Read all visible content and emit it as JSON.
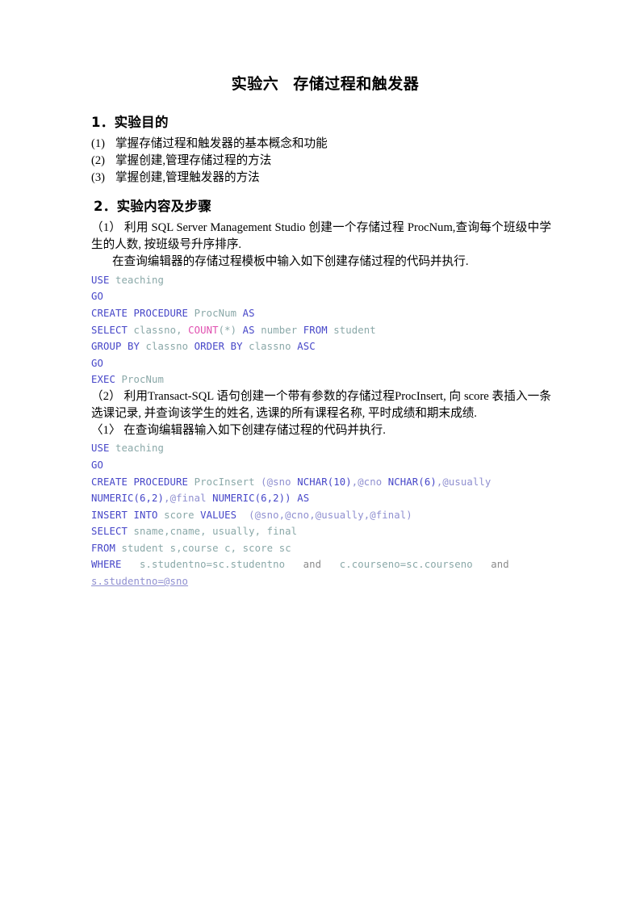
{
  "document": {
    "title_main": "实验六",
    "title_sub": "存储过程和触发器",
    "sections": [
      {
        "heading": "1．实验目的",
        "items": [
          {
            "num": "(1)",
            "text": "掌握存储过程和触发器的基本概念和功能"
          },
          {
            "num": "(2)",
            "text": "掌握创建,管理存储过程的方法"
          },
          {
            "num": "(3)",
            "text": "掌握创建,管理触发器的方法"
          }
        ]
      },
      {
        "heading": "2．实验内容及步骤",
        "paragraphs": [
          "（1） 利用 SQL Server Management Studio 创建一个存储过程 ProcNum,查询每个班级中学生的人数, 按班级号升序排序.",
          "在查询编辑器的存储过程模板中输入如下创建存储过程的代码并执行.",
          "（2） 利用Transact-SQL 语句创建一个带有参数的存储过程ProcInsert, 向 score 表插入一条选课记录, 并查询该学生的姓名, 选课的所有课程名称, 平时成绩和期末成绩.",
          "〈1〉 在查询编辑器输入如下创建存储过程的代码并执行."
        ]
      }
    ]
  },
  "code_block_1": {
    "lines": [
      [
        {
          "t": "USE",
          "c": "kw"
        },
        {
          "t": " ",
          "c": "plain"
        },
        {
          "t": "teaching",
          "c": "ident"
        }
      ],
      [
        {
          "t": "GO",
          "c": "kw"
        }
      ],
      [
        {
          "t": "CREATE PROCEDURE",
          "c": "kw"
        },
        {
          "t": " ",
          "c": "plain"
        },
        {
          "t": "ProcNum",
          "c": "ident"
        },
        {
          "t": " ",
          "c": "plain"
        },
        {
          "t": "AS",
          "c": "kw"
        }
      ],
      [
        {
          "t": "SELECT",
          "c": "kw"
        },
        {
          "t": " ",
          "c": "plain"
        },
        {
          "t": "classno,",
          "c": "ident"
        },
        {
          "t": " ",
          "c": "plain"
        },
        {
          "t": "COUNT",
          "c": "fn"
        },
        {
          "t": "(*)",
          "c": "ident"
        },
        {
          "t": " ",
          "c": "plain"
        },
        {
          "t": "AS",
          "c": "kw"
        },
        {
          "t": " ",
          "c": "plain"
        },
        {
          "t": "number",
          "c": "ident"
        },
        {
          "t": " ",
          "c": "plain"
        },
        {
          "t": "FROM",
          "c": "kw"
        },
        {
          "t": " ",
          "c": "plain"
        },
        {
          "t": "student",
          "c": "ident"
        }
      ],
      [
        {
          "t": "GROUP BY",
          "c": "kw"
        },
        {
          "t": " ",
          "c": "plain"
        },
        {
          "t": "classno",
          "c": "ident"
        },
        {
          "t": " ",
          "c": "plain"
        },
        {
          "t": "ORDER BY",
          "c": "kw"
        },
        {
          "t": " ",
          "c": "plain"
        },
        {
          "t": "classno",
          "c": "ident"
        },
        {
          "t": " ",
          "c": "plain"
        },
        {
          "t": "ASC",
          "c": "kw"
        }
      ],
      [
        {
          "t": "GO",
          "c": "kw"
        }
      ],
      [
        {
          "t": "EXEC",
          "c": "kw"
        },
        {
          "t": " ",
          "c": "plain"
        },
        {
          "t": "ProcNum",
          "c": "ident"
        }
      ]
    ],
    "plain_text": [
      "USE teaching",
      "GO",
      "CREATE PROCEDURE ProcNum AS",
      "SELECT classno, COUNT(*) AS number FROM student",
      "GROUP BY classno ORDER BY classno ASC",
      "GO",
      "EXEC ProcNum"
    ]
  },
  "code_block_2": {
    "lines": [
      [
        {
          "t": "USE",
          "c": "kw"
        },
        {
          "t": " ",
          "c": "plain"
        },
        {
          "t": "teaching",
          "c": "ident"
        }
      ],
      [
        {
          "t": "GO",
          "c": "kw"
        }
      ],
      [
        {
          "t": "CREATE PROCEDURE",
          "c": "kw"
        },
        {
          "t": " ",
          "c": "plain"
        },
        {
          "t": "ProcInsert",
          "c": "ident"
        },
        {
          "t": " ",
          "c": "plain"
        },
        {
          "t": "(@sno",
          "c": "var"
        },
        {
          "t": " ",
          "c": "plain"
        },
        {
          "t": "NCHAR",
          "c": "kw"
        },
        {
          "t": "(10)",
          "c": "kw"
        },
        {
          "t": ",",
          "c": "var"
        },
        {
          "t": "@cno",
          "c": "var"
        },
        {
          "t": " ",
          "c": "plain"
        },
        {
          "t": "NCHAR",
          "c": "kw"
        },
        {
          "t": "(6)",
          "c": "kw"
        },
        {
          "t": ",",
          "c": "var"
        },
        {
          "t": "@usually",
          "c": "var"
        }
      ],
      [
        {
          "t": "NUMERIC",
          "c": "kw"
        },
        {
          "t": "(6,2)",
          "c": "kw"
        },
        {
          "t": ",",
          "c": "var"
        },
        {
          "t": "@final",
          "c": "var"
        },
        {
          "t": " ",
          "c": "plain"
        },
        {
          "t": "NUMERIC",
          "c": "kw"
        },
        {
          "t": "(6,2))",
          "c": "kw"
        },
        {
          "t": " ",
          "c": "plain"
        },
        {
          "t": "AS",
          "c": "kw"
        }
      ],
      [
        {
          "t": "INSERT INTO",
          "c": "kw"
        },
        {
          "t": " ",
          "c": "plain"
        },
        {
          "t": "score",
          "c": "ident"
        },
        {
          "t": " ",
          "c": "plain"
        },
        {
          "t": "VALUES",
          "c": "kw"
        },
        {
          "t": "  ",
          "c": "plain"
        },
        {
          "t": "(@sno,@cno,@usually,@final)",
          "c": "var"
        }
      ],
      [
        {
          "t": "SELECT",
          "c": "kw"
        },
        {
          "t": " ",
          "c": "plain"
        },
        {
          "t": "sname,cname,",
          "c": "ident"
        },
        {
          "t": " ",
          "c": "plain"
        },
        {
          "t": "usually,",
          "c": "ident"
        },
        {
          "t": " ",
          "c": "plain"
        },
        {
          "t": "final",
          "c": "ident"
        }
      ],
      [
        {
          "t": "FROM",
          "c": "kw"
        },
        {
          "t": " ",
          "c": "plain"
        },
        {
          "t": "student",
          "c": "ident"
        },
        {
          "t": " ",
          "c": "plain"
        },
        {
          "t": "s,course",
          "c": "ident"
        },
        {
          "t": " ",
          "c": "plain"
        },
        {
          "t": "c,",
          "c": "ident"
        },
        {
          "t": " ",
          "c": "plain"
        },
        {
          "t": "score",
          "c": "ident"
        },
        {
          "t": " ",
          "c": "plain"
        },
        {
          "t": "sc",
          "c": "ident"
        }
      ],
      [
        {
          "t": "WHERE",
          "c": "kw"
        },
        {
          "t": "   ",
          "c": "plain"
        },
        {
          "t": "s.studentno=sc.studentno",
          "c": "ident"
        },
        {
          "t": "   ",
          "c": "plain"
        },
        {
          "t": "and",
          "c": "plain"
        },
        {
          "t": "   ",
          "c": "plain"
        },
        {
          "t": "c.courseno=sc.courseno",
          "c": "ident"
        },
        {
          "t": "   ",
          "c": "plain"
        },
        {
          "t": "and",
          "c": "plain"
        }
      ],
      [
        {
          "t": "s.studentno=@sno",
          "c": "var ul"
        }
      ]
    ],
    "plain_text": [
      "USE teaching",
      "GO",
      "CREATE PROCEDURE ProcInsert (@sno NCHAR(10),@cno NCHAR(6),@usually",
      "NUMERIC(6,2),@final NUMERIC(6,2)) AS",
      "INSERT INTO score VALUES  (@sno,@cno,@usually,@final)",
      "SELECT sname,cname, usually, final",
      "FROM student s,course c, score sc",
      "WHERE   s.studentno=sc.studentno   and   c.courseno=sc.courseno   and",
      "s.studentno=@sno"
    ]
  },
  "colors": {
    "keyword": "#4646c8",
    "identifier": "#8aa8a8",
    "function": "#e050b0",
    "variable": "#8f8fd0",
    "low_emphasis": "#8a8a8a",
    "text": "#000000",
    "background": "#ffffff"
  }
}
